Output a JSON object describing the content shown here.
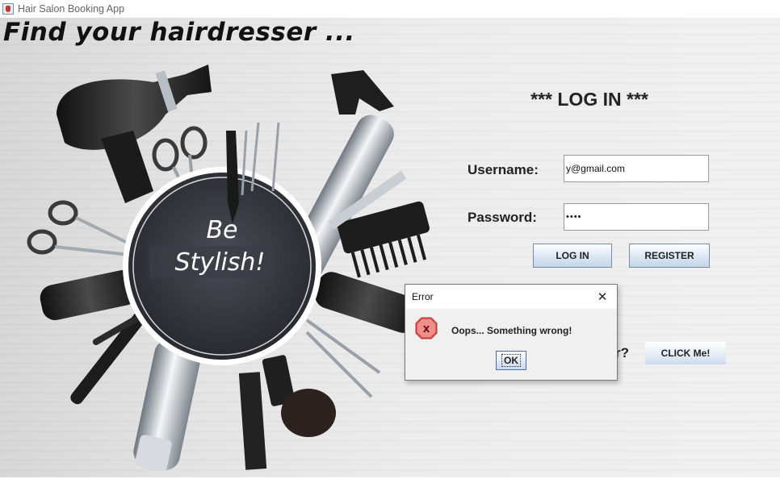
{
  "window": {
    "title": "Hair Salon Booking App",
    "icon": "java-app-icon"
  },
  "banner": {
    "headline": "Find your hairdresser ...",
    "badge_line1": "Be",
    "badge_line2": "Stylish!"
  },
  "login": {
    "heading": "*** LOG IN ***",
    "username_label": "Username:",
    "username_value": "y@gmail.com",
    "password_label": "Password:",
    "password_value": "••••",
    "login_button": "LOG IN",
    "register_button": "REGISTER",
    "forgot_question_visible": "r?",
    "click_me_button": "CLICK Me!"
  },
  "error_dialog": {
    "title": "Error",
    "close_glyph": "✕",
    "icon": "error-icon",
    "icon_glyph": "x",
    "message": "Oops... Something wrong!",
    "ok_button": "OK"
  },
  "colors": {
    "button_top": "#ffffff",
    "button_bottom": "#c4d5e9",
    "error_red": "#d9443f",
    "badge": "#2d2f36"
  }
}
